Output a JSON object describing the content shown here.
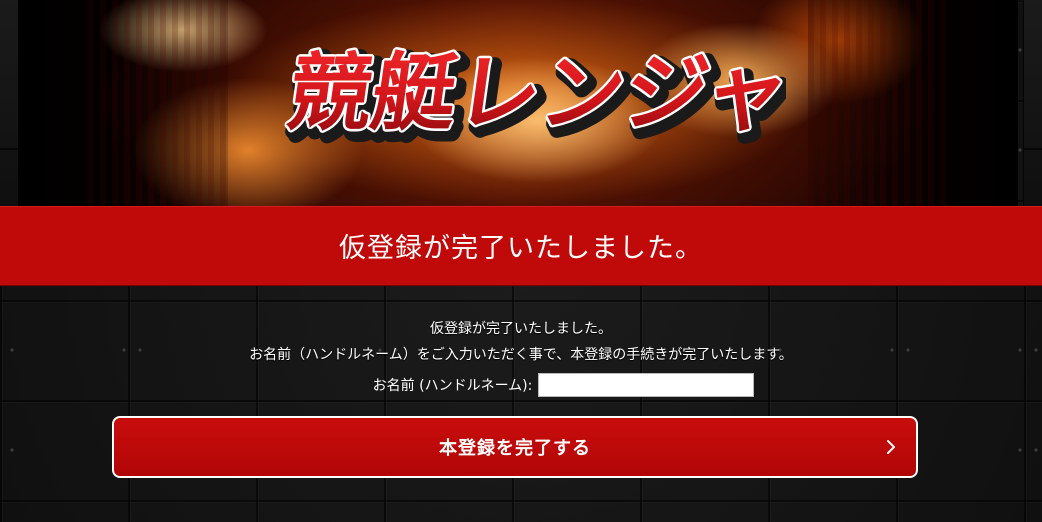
{
  "hero": {
    "logo_text": "競艇レンジャ",
    "colors": {
      "logo_red": "#d3161b",
      "logo_outline": "#ffffff",
      "fire": "#f08a1c"
    }
  },
  "banner": {
    "title": "仮登録が完了いたしました。",
    "color": "#c00a0a"
  },
  "main": {
    "message_line1": "仮登録が完了いたしました。",
    "message_line2": "お名前（ハンドルネーム）をご入力いただく事で、本登録の手続きが完了いたします。",
    "name_label": "お名前 (ハンドルネーム):",
    "name_value": "",
    "submit_label": "本登録を完了する",
    "submit_icon": "chevron-right-icon",
    "submit_color": "#c00a0a"
  }
}
